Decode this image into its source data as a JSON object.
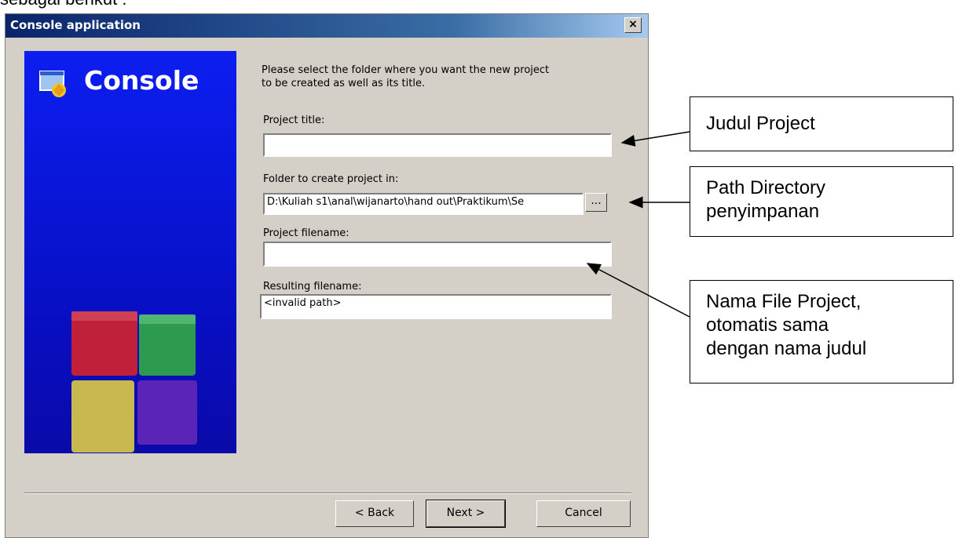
{
  "page": {
    "top_caption": "sebagai berikut :"
  },
  "dialog": {
    "title": "Console application",
    "close_label": "×",
    "banner": {
      "title": "Console"
    },
    "intro_text_line1": "Please select the folder where you want the new project",
    "intro_text_line2": "to be created as well as its title.",
    "project_title": {
      "label": "Project title:",
      "value": ""
    },
    "folder": {
      "label": "Folder to create project in:",
      "value": "D:\\Kuliah s1\\anal\\wijanarto\\hand out\\Praktikum\\Se",
      "browse_label": "..."
    },
    "project_filename": {
      "label": "Project filename:",
      "value": ""
    },
    "resulting_filename": {
      "label": "Resulting filename:",
      "value": "<invalid path>"
    },
    "buttons": {
      "back": "< Back",
      "next": "Next >",
      "cancel": "Cancel"
    }
  },
  "annotations": {
    "judul": "Judul Project",
    "path_line1": "Path Directory",
    "path_line2": "penyimpanan",
    "nama_line1": "Nama File Project,",
    "nama_line2": "otomatis sama",
    "nama_line3": "dengan nama judul"
  },
  "colors": {
    "banner_blue": "#0c1ef0",
    "dialog_gray": "#d4d0c8",
    "title_bar": "#0a246a"
  }
}
